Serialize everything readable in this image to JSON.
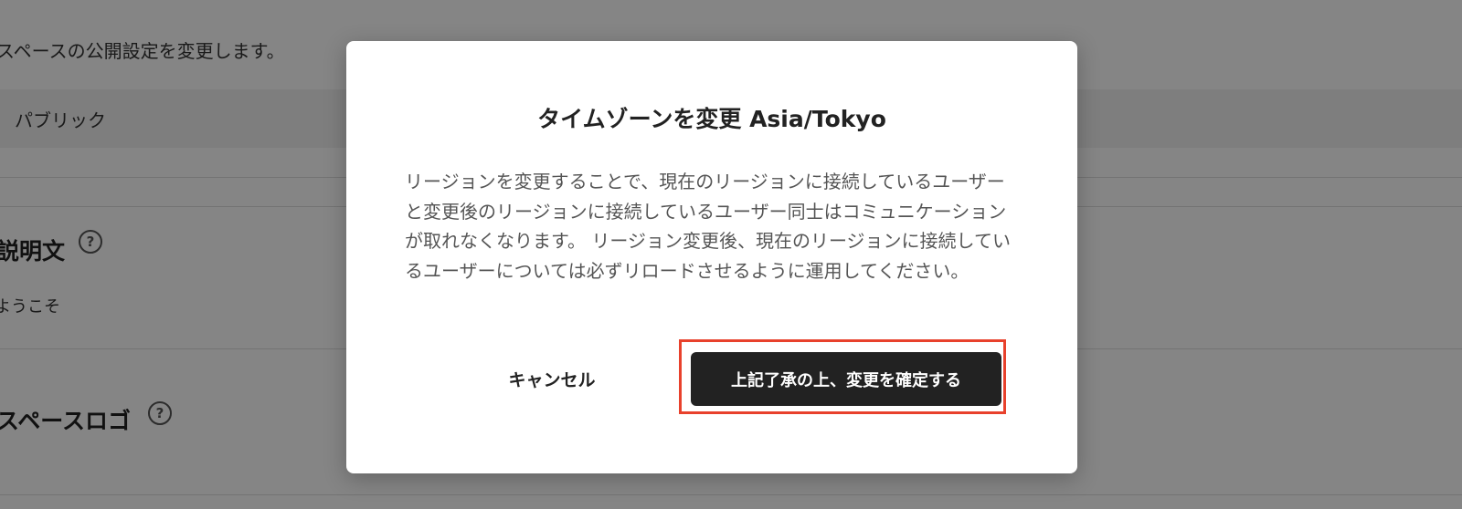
{
  "background": {
    "visibility_description": "スペースの公開設定を変更します。",
    "visibility_value": "パブリック",
    "description_heading": "説明文",
    "description_value": "ようこそ",
    "logo_heading": "スペースロゴ",
    "help_glyph": "?"
  },
  "dialog": {
    "title": "タイムゾーンを変更 Asia/Tokyo",
    "body": "リージョンを変更することで、現在のリージョンに接続しているユーザーと変更後のリージョンに接続しているユーザー同士はコミュニケーションが取れなくなります。 リージョン変更後、現在のリージョンに接続しているユーザーについては必ずリロードさせるように運用してください。",
    "cancel_label": "キャンセル",
    "confirm_label": "上記了承の上、変更を確定する"
  },
  "colors": {
    "highlight": "#e8412c",
    "primary_button": "#222222",
    "overlay": "rgba(0,0,0,0.48)"
  }
}
